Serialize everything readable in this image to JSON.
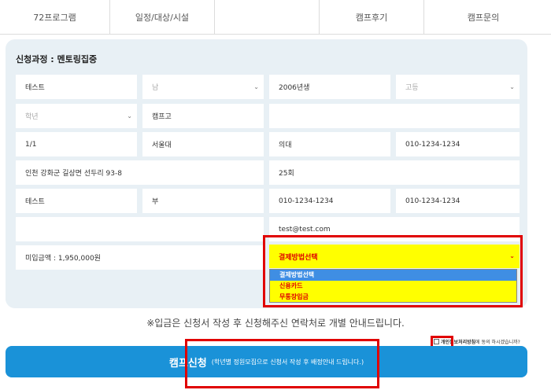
{
  "tabs": [
    "72프로그램",
    "일정/대상/시설",
    "",
    "캠프후기",
    "캠프문의"
  ],
  "form": {
    "title": "신청과정 : 멘토링집중",
    "row1": {
      "name": "테스트",
      "gender": "남",
      "birth": "2006년생",
      "school_level": "고등"
    },
    "row2": {
      "grade": "학년",
      "school": "캠프고",
      "extra": ""
    },
    "row3": {
      "class": "1/1",
      "region": "서울대",
      "major": "의대",
      "phone": "010-1234-1234"
    },
    "row4": {
      "address": "인천 강화군 길상면 선두리 93-8",
      "count": "25회"
    },
    "row5": {
      "parent_name": "테스트",
      "relation": "부",
      "parent_phone": "010-1234-1234",
      "parent_phone2": "010-1234-1234"
    },
    "row6": {
      "note": "",
      "email": "test@test.com"
    },
    "row7": {
      "deposit": "미입금액 : 1,950,000원"
    }
  },
  "payment": {
    "selected": "결제방법선택",
    "options": [
      "결제방법선택",
      "신용카드",
      "무통장입금"
    ]
  },
  "notice": "※입금은 신청서 작성 후 신청해주신 연락처로 개별 안내드립니다.",
  "agree": {
    "bold": "개인정보처리방침",
    "rest": "에 동의 하시겠습니까?"
  },
  "apply": {
    "label": "캠프신청",
    "sub": "(학년별 정원모집으로 신청서 작성 후 배정안내 드립니다.)"
  },
  "colors": {
    "accent": "#1a92d8",
    "highlight": "#ffff00",
    "warning_red": "#e00000"
  }
}
